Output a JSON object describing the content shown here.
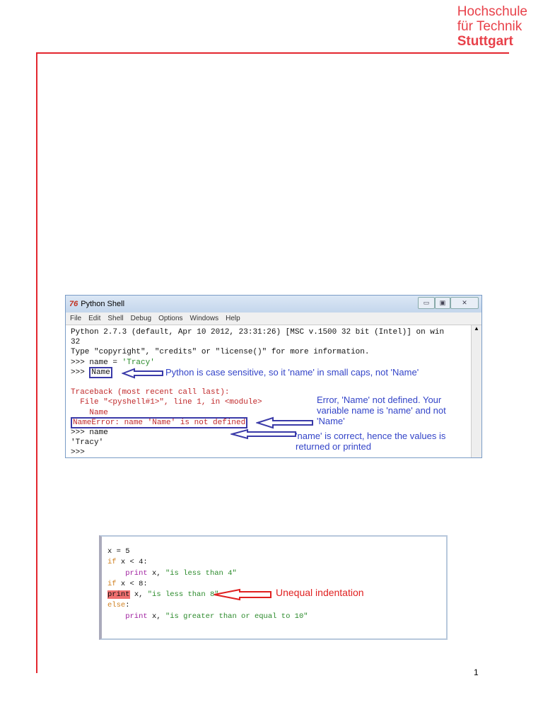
{
  "logo": {
    "line1": "Hochschule",
    "line2": "für Technik",
    "line3": "Stuttgart"
  },
  "shell": {
    "title": "Python Shell",
    "icon": "python-idle-icon",
    "window_buttons": {
      "minimize": "▭",
      "maximize": "▣",
      "close": "✕"
    },
    "menu": [
      "File",
      "Edit",
      "Shell",
      "Debug",
      "Options",
      "Windows",
      "Help"
    ],
    "lines": {
      "l1": "Python 2.7.3 (default, Apr 10 2012, 23:31:26) [MSC v.1500 32 bit (Intel)] on win",
      "l2": "32",
      "l3": "Type \"copyright\", \"credits\" or \"license()\" for more information.",
      "l4a": ">>> name = ",
      "l4b": "'Tracy'",
      "l5a": ">>> ",
      "l5b": "Name",
      "l7": "Traceback (most recent call last):",
      "l8": "  File \"<pyshell#1>\", line 1, in <module>",
      "l9": "    Name",
      "l10": "NameError: name 'Name' is not defined",
      "l11": ">>> name",
      "l12": "'Tracy'",
      "l13": ">>>"
    },
    "notes": {
      "case": "Python is case sensitive, so it 'name' in small caps, not 'Name'",
      "error": "Error, 'Name' not defined. Your variable name is 'name' and not 'Name'",
      "correct": "'name' is correct, hence the values is returned or printed"
    }
  },
  "code2": {
    "l1": "x = 5",
    "l2a": "if",
    " l2b": " x < 4:",
    "l3a": "    print",
    "l3b": " x, ",
    "l3c": "\"is less than 4\"",
    "l4a": "if",
    "l4b": " x < 8:",
    "l5a": "print",
    "l5b": " x, ",
    "l5c": "\"is less than 8\"",
    "l6a": "else",
    "l6b": ":",
    "l7a": "    print",
    "l7b": " x, ",
    "l7c": "\"is greater than or equal to 10\"",
    "note": "Unequal indentation"
  },
  "page_number": "1"
}
